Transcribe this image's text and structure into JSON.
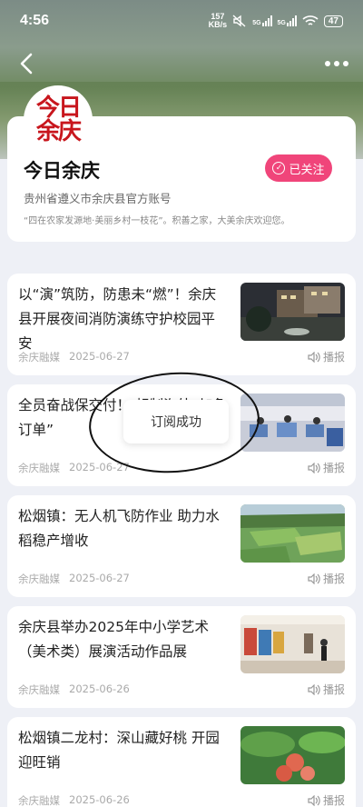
{
  "status_bar": {
    "time": "4:56",
    "net_speed_value": "157",
    "net_speed_unit": "KB/s",
    "battery": "47"
  },
  "profile": {
    "logo_line1": "今日",
    "logo_line2": "余庆",
    "name": "今日余庆",
    "follow_label": "已关注",
    "description": "贵州省遵义市余庆县官方账号",
    "motto": "“四在农家发源地·美丽乡村一枝花”。积善之家，大美余庆欢迎您。"
  },
  "toast": {
    "message": "订阅成功"
  },
  "news": [
    {
      "title": "以“演”筑防，防患未“燃”！余庆县开展夜间消防演练守护校园平安",
      "source": "余庆融媒",
      "date": "2025-06-27",
      "play_label": "播报"
    },
    {
      "title": "全员奋战保交付！                 赶制海外“加急订单”",
      "source": "余庆融媒",
      "date": "2025-06-27",
      "play_label": "播报"
    },
    {
      "title": "松烟镇：无人机飞防作业 助力水稻稳产增收",
      "source": "余庆融媒",
      "date": "2025-06-27",
      "play_label": "播报"
    },
    {
      "title": "余庆县举办2025年中小学艺术（美术类）展演活动作品展",
      "source": "余庆融媒",
      "date": "2025-06-26",
      "play_label": "播报"
    },
    {
      "title": "松烟镇二龙村：深山藏好桃 开园迎旺销",
      "source": "余庆融媒",
      "date": "2025-06-26",
      "play_label": "播报"
    }
  ]
}
